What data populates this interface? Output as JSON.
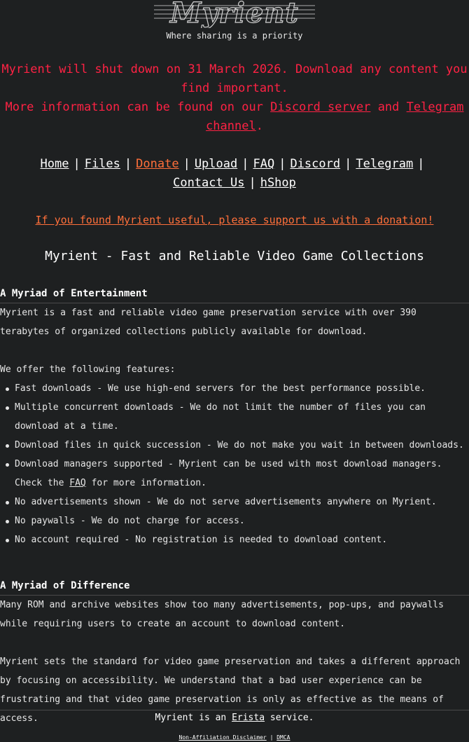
{
  "logo": {
    "text": "Myrient"
  },
  "tagline": "Where sharing is a priority",
  "notice": {
    "line1": "Myrient will shut down on 31 March 2026. Download any content you find important.",
    "line2_prefix": "More information can be found on our ",
    "discord_link": "Discord server",
    "line2_mid": " and ",
    "telegram_link": "Telegram channel",
    "line2_suffix": "."
  },
  "nav": {
    "separator": "|",
    "home": "Home",
    "files": "Files",
    "donate": "Donate",
    "upload": "Upload",
    "faq": "FAQ",
    "discord": "Discord",
    "telegram": "Telegram",
    "contact": "Contact Us",
    "hshop": "hShop"
  },
  "support_link": "If you found Myrient useful, please support us with a donation!",
  "headline": "Myrient - Fast and Reliable Video Game Collections",
  "section1": {
    "title": "A Myriad of Entertainment",
    "intro": "Myrient is a fast and reliable video game preservation service with over 390 terabytes of organized collections publicly available for download.",
    "features_intro": "We offer the following features:",
    "features": [
      "Fast downloads - We use high-end servers for the best performance possible.",
      "Multiple concurrent downloads - We do not limit the number of files you can download at a time.",
      "Download files in quick succession - We do not make you wait in between downloads.",
      "No advertisements shown - We do not serve advertisements anywhere on Myrient.",
      "No paywalls - We do not charge for access.",
      "No account required - No registration is needed to download content."
    ],
    "managers_prefix": "Download managers supported - Myrient can be used with most download managers. Check the ",
    "managers_link": "FAQ",
    "managers_suffix": " for more information."
  },
  "section2": {
    "title": "A Myriad of Difference",
    "para1": "Many ROM and archive websites show too many advertisements, pop-ups, and paywalls while requiring users to create an account to download content.",
    "para2": "Myrient sets the standard for video game preservation and takes a different approach by focusing on accessibility. We understand that a bad user experience can be frustrating and that video game preservation is only as effective as the means of access."
  },
  "footer": {
    "prefix": "Myrient is an ",
    "link": "Erista",
    "suffix": " service.",
    "disclaimer": "Non-Affiliation Disclaimer",
    "separator": "|",
    "dmca": "DMCA"
  }
}
